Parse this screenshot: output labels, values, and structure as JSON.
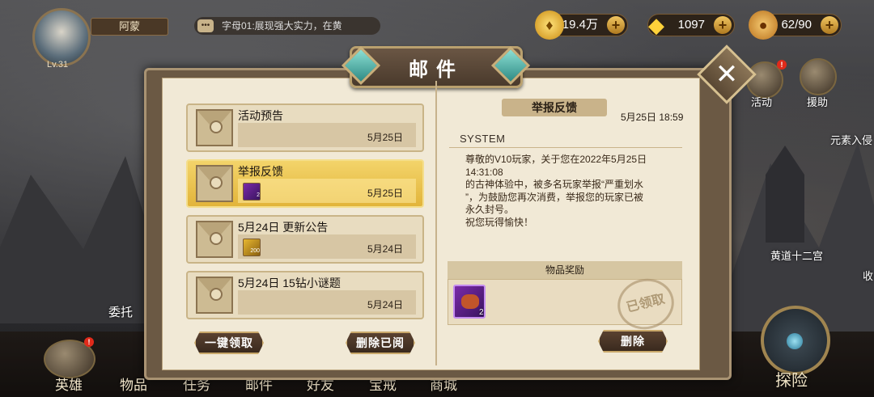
{
  "player": {
    "name": "阿蒙",
    "level": "Lv.31"
  },
  "chat": {
    "icon": "•••",
    "text": "字母01:展现强大实力，在黄"
  },
  "resources": {
    "gold": "19.4万",
    "diamond": "1097",
    "stamina": "62/90"
  },
  "side": {
    "activity": "活动",
    "assist": "援助",
    "commission": "委托",
    "elemental": "元素入侵",
    "zodiac": "黄道十二宫",
    "right_edge": "收"
  },
  "bottom_nav": [
    "英雄",
    "物品",
    "任务",
    "邮件",
    "好友",
    "宝戒",
    "商城"
  ],
  "explore": "探险",
  "dialog": {
    "title": "邮件",
    "mails": [
      {
        "title": "活动预告",
        "date": "5月25日",
        "item_qty": ""
      },
      {
        "title": "举报反馈",
        "date": "5月25日",
        "item_qty": "2"
      },
      {
        "title": "5月24日 更新公告",
        "date": "5月24日",
        "item_qty": "200"
      },
      {
        "title": "5月24日 15钻小谜题",
        "date": "5月24日",
        "item_qty": ""
      }
    ],
    "claim_all": "一键领取",
    "delete_read": "删除已阅",
    "detail": {
      "tag": "举报反馈",
      "time": "5月25日 18:59",
      "sender": "SYSTEM",
      "body": "尊敬的V10玩家，关于您在2022年5月25日\n14:31:08\n的古神体验中，被多名玩家举报“严重划水\n”，为鼓励您再次消费，举报您的玩家已被\n永久封号。\n祝您玩得愉快！",
      "reward_header": "物品奖励",
      "reward_qty": "2",
      "stamp": "已领取",
      "delete": "删除"
    }
  }
}
